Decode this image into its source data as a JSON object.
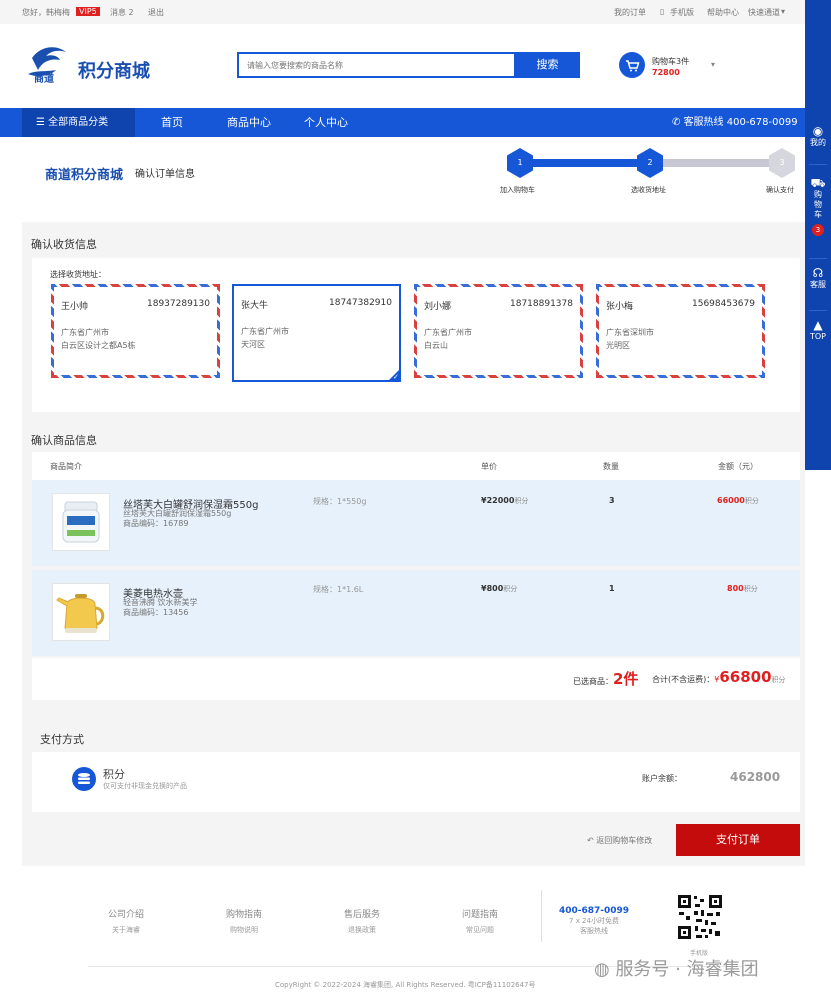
{
  "topbar": {
    "greeting": "您好，韩梅梅",
    "vip": "VIP5",
    "messages": "消息 2",
    "logout": "退出",
    "my_orders": "我的订单",
    "mobile": "手机版",
    "help": "帮助中心",
    "quick": "快速通道"
  },
  "header": {
    "logo_badge": "商道",
    "logo_text": "积分商城",
    "search_placeholder": "请输入您要搜索的商品名称",
    "search_button": "搜索",
    "cart_label": "购物车3件",
    "cart_points": "72800"
  },
  "nav": {
    "all_categories": "全部商品分类",
    "items": [
      "首页",
      "商品中心",
      "个人中心"
    ],
    "hotline": "客服热线 400-678-0099"
  },
  "sidebar": {
    "mine": "我的",
    "cart": "购物车",
    "cart_count": "3",
    "service": "客服",
    "top": "TOP"
  },
  "steps": {
    "brand": "商道积分商城",
    "title": "确认订单信息",
    "items": [
      {
        "num": "1",
        "label": "加入购物车"
      },
      {
        "num": "2",
        "label": "选收货地址"
      },
      {
        "num": "3",
        "label": "确认支付"
      }
    ]
  },
  "address": {
    "section_title": "确认收货信息",
    "select_label": "选择收货地址：",
    "cards": [
      {
        "name": "王小帅",
        "phone": "18937289130",
        "line1": "广东省广州市",
        "line2": "白云区设计之都A5栋"
      },
      {
        "name": "张大牛",
        "phone": "18747382910",
        "line1": "广东省广州市",
        "line2": "天河区"
      },
      {
        "name": "刘小娜",
        "phone": "18718891378",
        "line1": "广东省广州市",
        "line2": "白云山"
      },
      {
        "name": "张小梅",
        "phone": "15698453679",
        "line1": "广东省深圳市",
        "line2": "光明区"
      }
    ]
  },
  "goods": {
    "section_title": "确认商品信息",
    "headers": [
      "商品简介",
      "单价",
      "数量",
      "金额（元）"
    ],
    "points_unit": "积分",
    "rows": [
      {
        "name": "丝塔芙大白罐舒润保湿霜550g",
        "sub": "丝塔芙大白罐舒润保湿霜550g",
        "code": "商品编码：16789",
        "spec": "规格：1*550g",
        "price": "¥22000",
        "qty": "3",
        "amount": "66000"
      },
      {
        "name": "美菱电热水壶",
        "sub": "轻音沸腾 饮水新美学",
        "code": "商品编码：13456",
        "spec": "规格：1*1.6L",
        "price": "¥800",
        "qty": "1",
        "amount": "800"
      }
    ],
    "selected_label": "已选商品：",
    "selected_count": "2件",
    "total_label": "合计(不含运费)：",
    "total_symbol": "¥",
    "total_value": "66800",
    "total_unit": "积分"
  },
  "payment": {
    "section_title": "支付方式",
    "method": "积分",
    "desc": "仅可支付非现金兑换的产品",
    "balance_label": "账户余额：",
    "balance": "462800",
    "back_link": "返回购物车修改",
    "submit": "支付订单"
  },
  "footer": {
    "cols": [
      {
        "title": "公司介绍",
        "sub": "关于海睿"
      },
      {
        "title": "购物指南",
        "sub": "购物说明"
      },
      {
        "title": "售后服务",
        "sub": "退换政策"
      },
      {
        "title": "问题指南",
        "sub": "常见问题"
      }
    ],
    "hotline": "400-687-0099",
    "hotline_sub1": "7 x 24小时免费",
    "hotline_sub2": "客服热线",
    "qr_label": "手机版",
    "copyright": "CopyRight © 2022-2024 海睿集团, All Rights Reserved. 粤ICP备11102647号"
  },
  "watermark": "服务号 · 海睿集团",
  "colors": {
    "primary": "#1557d6",
    "danger": "#e02020",
    "submit": "#c40c0c",
    "row_bg": "#e6f1fb"
  }
}
